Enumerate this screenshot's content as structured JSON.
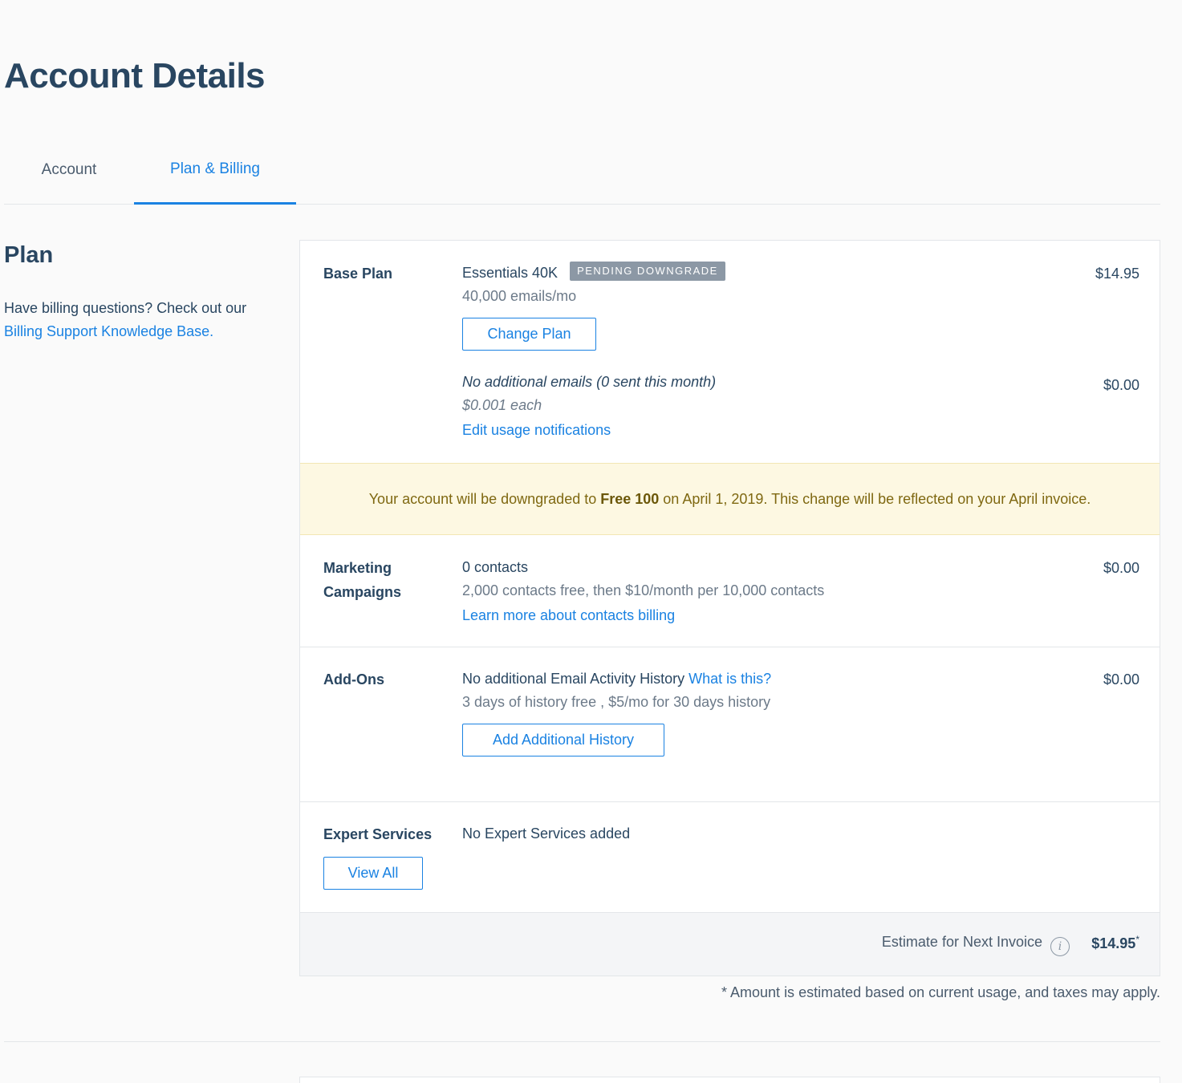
{
  "page": {
    "title": "Account Details"
  },
  "tabs": [
    {
      "label": "Account",
      "active": false
    },
    {
      "label": "Plan & Billing",
      "active": true
    }
  ],
  "sidebar": {
    "title": "Plan",
    "help_text": "Have billing questions? Check out our",
    "help_link": "Billing Support Knowledge Base."
  },
  "base_plan": {
    "label": "Base Plan",
    "plan_name": "Essentials 40K",
    "badge": "PENDING DOWNGRADE",
    "allowance": "40,000 emails/mo",
    "price": "$14.95",
    "change_button": "Change Plan",
    "extra_emails": "No additional emails (0 sent this month)",
    "extra_rate": "$0.001 each",
    "extra_price": "$0.00",
    "edit_link": "Edit usage notifications"
  },
  "notice": {
    "prefix": "Your account will be downgraded to ",
    "plan": "Free 100",
    "suffix": " on April 1, 2019. This change will be reflected on your April invoice."
  },
  "marketing": {
    "label_line1": "Marketing",
    "label_line2": "Campaigns",
    "contacts": "0 contacts",
    "pricing": "2,000 contacts free, then $10/month per 10,000 contacts",
    "learn_link": "Learn more about contacts billing",
    "price": "$0.00"
  },
  "addons": {
    "label": "Add-Ons",
    "title": "No additional Email Activity History",
    "what_link": "What is this?",
    "detail": "3 days of history free , $5/mo for 30 days history",
    "button": "Add Additional History",
    "price": "$0.00"
  },
  "expert": {
    "label": "Expert Services",
    "text": "No Expert Services added",
    "button": "View All"
  },
  "estimate": {
    "label": "Estimate for Next Invoice",
    "total": "$14.95",
    "asterisk": "*",
    "info_icon": "info-icon",
    "info_glyph": "i"
  },
  "disclaimer": "* Amount is estimated based on current usage, and taxes may apply.",
  "colors": {
    "accent": "#1a82e2",
    "heading": "#294661",
    "notice_bg": "#fdf8e2",
    "badge_bg": "#8c98a5"
  }
}
